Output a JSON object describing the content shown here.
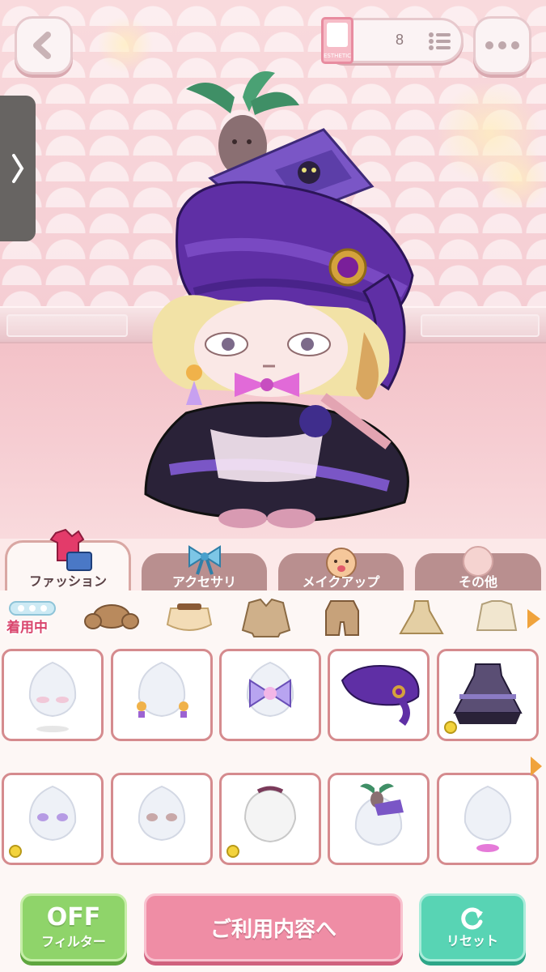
{
  "header": {
    "card_label": "ESTHETIC",
    "card_count": "8"
  },
  "tabs": [
    {
      "label": "ファッション",
      "active": true
    },
    {
      "label": "アクセサリ",
      "active": false
    },
    {
      "label": "メイクアップ",
      "active": false
    },
    {
      "label": "その他",
      "active": false
    }
  ],
  "subcategory": {
    "wearing_label": "着用中"
  },
  "buttons": {
    "filter_state": "OFF",
    "filter_label": "フィルター",
    "usage_label": "ご利用内容へ",
    "reset_label": "リセット"
  },
  "colors": {
    "accent_pink": "#ef8da5",
    "accent_green": "#8fd46a",
    "accent_teal": "#58d4b4",
    "tab_inactive": "#b98f8f",
    "cell_border": "#d58b8e"
  }
}
